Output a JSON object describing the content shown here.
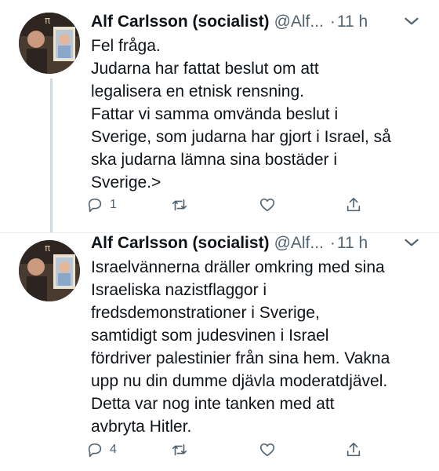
{
  "tweets": [
    {
      "author_name": "Alf Carlsson (socialist)",
      "handle": "@Alf...",
      "separator": "·",
      "time": "11 h",
      "lines": [
        "Fel fråga.",
        "Judarna har fattat beslut om att",
        "legalisera en etnisk rensning.",
        "Fattar vi samma omvända beslut i",
        "Sverige, som judarna har gjort i Israel, så",
        "ska judarna lämna sina bostäder i",
        "Sverige.>"
      ],
      "reply_count": "1",
      "retweet_count": "",
      "like_count": ""
    },
    {
      "author_name": "Alf Carlsson (socialist)",
      "handle": "@Alf...",
      "separator": "·",
      "time": "11 h",
      "lines": [
        "Israelvännerna dräller omkring med sina",
        "Israeliska nazistflaggor i",
        "fredsdemonstrationer i Sverige,",
        "samtidigt som judesvinen i Israel",
        "fördriver palestinier från sina hem. Vakna",
        "upp nu din dumme djävla moderatdjävel.",
        "Detta var nog inte tanken med att",
        "avbryta Hitler."
      ],
      "reply_count": "4",
      "retweet_count": "",
      "like_count": ""
    }
  ],
  "icons": {
    "more": "chevron-down-icon",
    "reply": "reply-icon",
    "retweet": "retweet-icon",
    "like": "heart-icon",
    "share": "share-icon"
  },
  "colors": {
    "text": "#0f1419",
    "secondary": "#536471",
    "thread_line": "#cfd9de"
  }
}
